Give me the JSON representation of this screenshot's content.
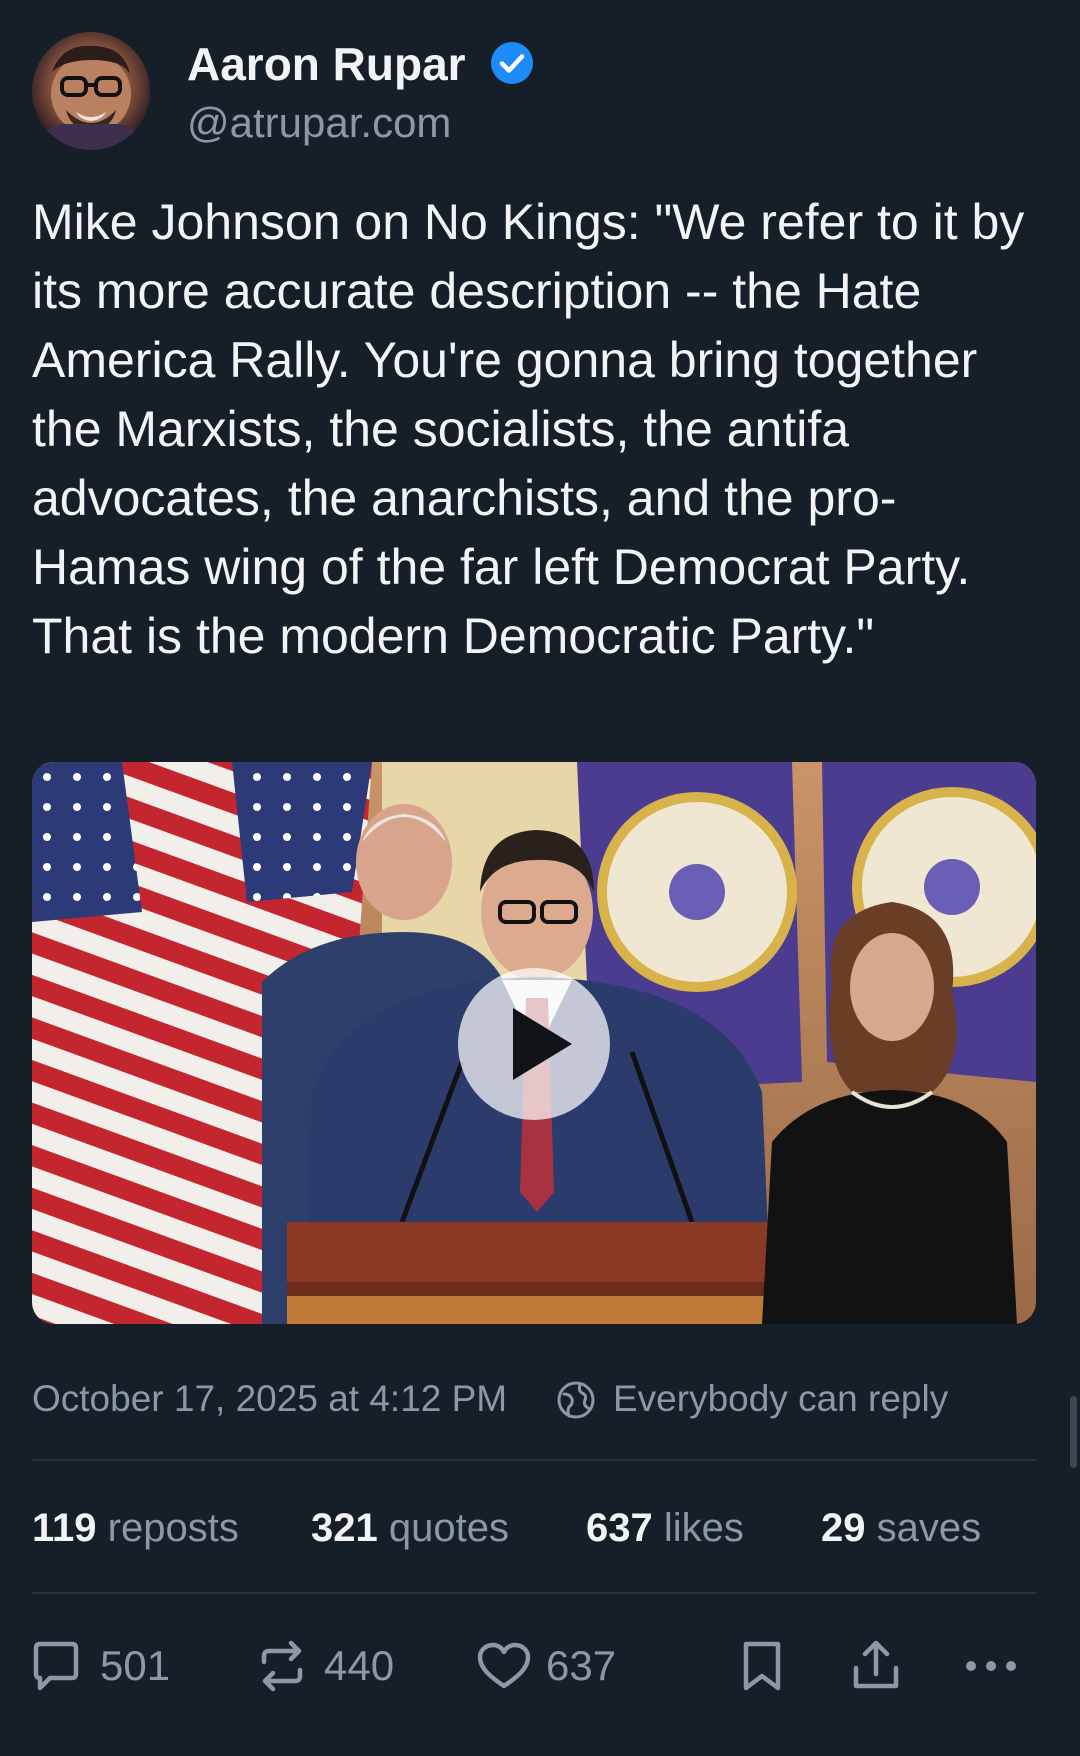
{
  "author": {
    "display_name": "Aaron Rupar",
    "handle": "@atrupar.com",
    "verified": true,
    "verified_color": "#1d8cf8"
  },
  "post": {
    "text": "Mike Johnson on No Kings: \"We refer to it by its more accurate description -- the Hate America Rally. You're gonna bring together the Marxists, the socialists, the antifa advocates, the anarchists, and the pro-Hamas wing of the far left Democrat Party. That is the modern Democratic Party.\""
  },
  "media": {
    "type": "video",
    "play_icon": "play-icon"
  },
  "meta": {
    "timestamp": "October 17, 2025 at 4:12 PM",
    "reply_setting": "Everybody can reply"
  },
  "stats": [
    {
      "count": "119",
      "label": "reposts"
    },
    {
      "count": "321",
      "label": "quotes"
    },
    {
      "count": "637",
      "label": "likes"
    },
    {
      "count": "29",
      "label": "saves"
    }
  ],
  "actions": {
    "replies": "501",
    "reposts": "440",
    "likes": "637"
  },
  "colors": {
    "background": "#161e27",
    "text": "#f1f3f5",
    "muted": "#8b98a5",
    "divider": "#2a333d"
  }
}
